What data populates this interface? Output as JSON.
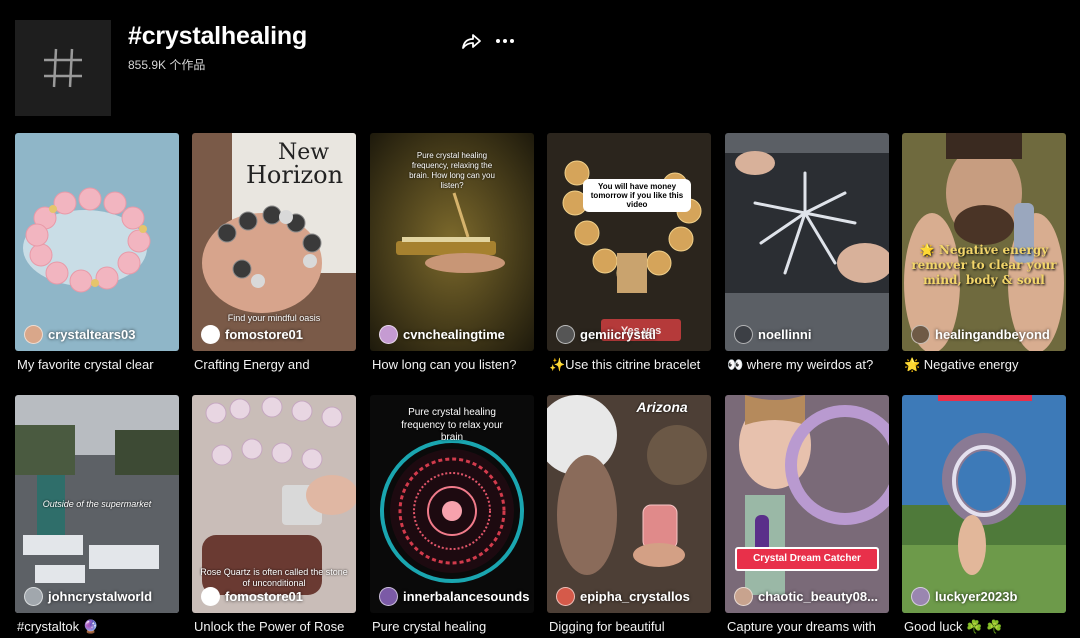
{
  "header": {
    "title": "#crystalhealing",
    "count": "855.9K 个作品",
    "share_icon": "share-icon",
    "more_icon": "more-options-icon"
  },
  "videos": [
    {
      "author": "crystaltears03",
      "caption": "My favorite crystal clear",
      "overlay": "",
      "color": "#8fb6c8"
    },
    {
      "author": "fomostore01",
      "caption": "Crafting Energy and",
      "overlay": "Find your mindful oasis",
      "color": "#a07a63"
    },
    {
      "author": "cvnchealingtime",
      "caption": "How long can you listen?",
      "overlay": "Pure crystal healing frequency, relaxing the brain. How long can you listen?",
      "color": "#6b5523"
    },
    {
      "author": "gemiicrystal",
      "caption": "✨Use this citrine bracelet",
      "overlay": "You will have money tomorrow if you like this video",
      "badge": "Yes yes",
      "color": "#3b3226"
    },
    {
      "author": "noellinni",
      "caption": "👀 where my weirdos at?",
      "overlay": "",
      "color": "#555a62"
    },
    {
      "author": "healingandbeyond",
      "caption": "🌟 Negative energy",
      "overlay": "🌟 Negative energy remover to clear your mind, body & soul",
      "color": "#8a7157"
    },
    {
      "author": "johncrystalworld",
      "caption": "#crystaltok 🔮",
      "overlay": "Outside of the supermarket",
      "color": "#8c9399"
    },
    {
      "author": "fomostore01",
      "caption": "Unlock the Power of Rose",
      "overlay": "Rose Quartz is often called the stone of unconditional",
      "color": "#b8a7a3"
    },
    {
      "author": "innerbalancesounds",
      "caption": "Pure crystal healing",
      "overlay": "Pure crystal healing frequency to relax your brain",
      "color": "#0b0b0b"
    },
    {
      "author": "epipha_crystallos",
      "caption": "Digging for beautiful",
      "overlay": "Arizona",
      "color": "#5a4a3f"
    },
    {
      "author": "chaotic_beauty08...",
      "caption": "Capture your dreams with",
      "overlay": "Crystal Dream Catcher",
      "color": "#8c7a8a"
    },
    {
      "author": "luckyer2023b",
      "caption": "Good luck ☘️ ☘️",
      "overlay": "",
      "color": "#3d7ab8"
    }
  ]
}
